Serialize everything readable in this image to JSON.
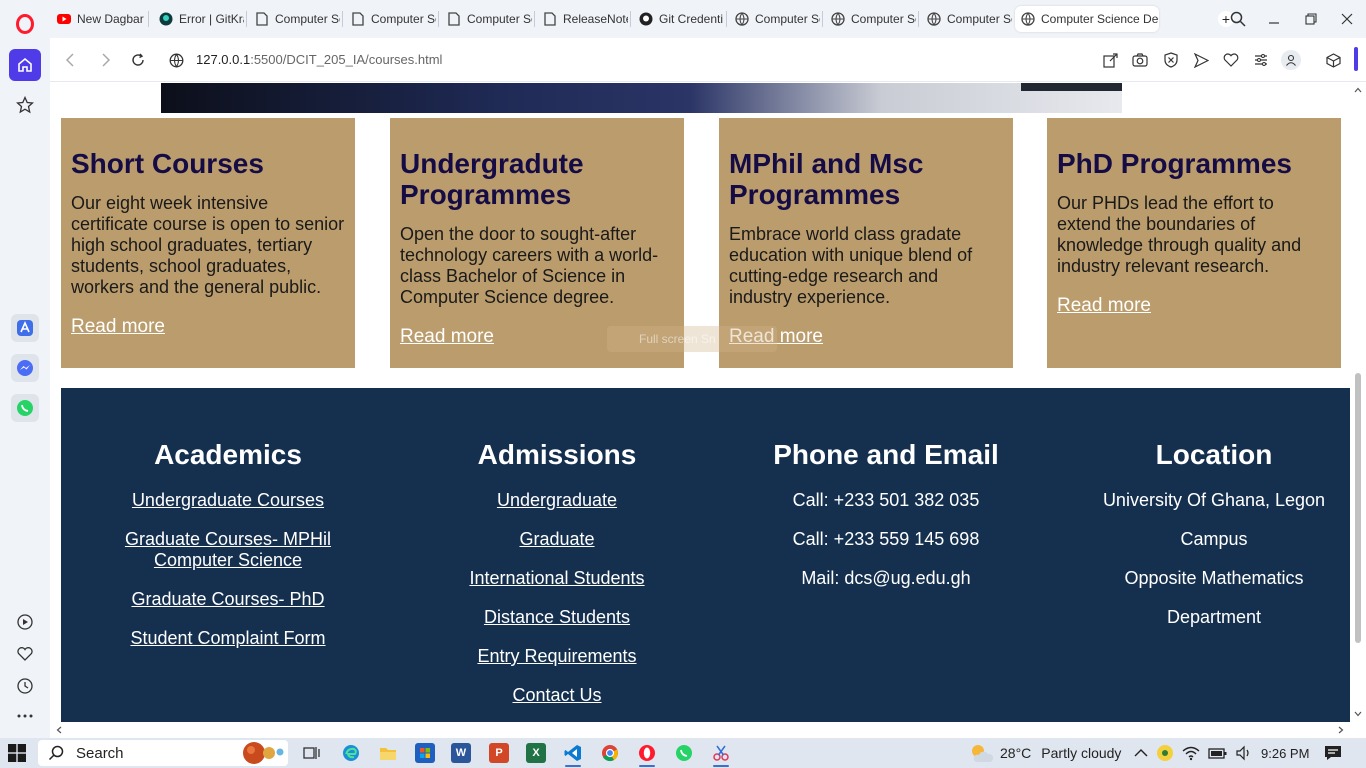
{
  "browser": {
    "tabs": [
      {
        "label": "New Dagbar",
        "icon": "youtube-icon"
      },
      {
        "label": "Error | GitKra",
        "icon": "gitkraken-icon"
      },
      {
        "label": "Computer Sc",
        "icon": "document-icon"
      },
      {
        "label": "Computer Sc",
        "icon": "document-icon"
      },
      {
        "label": "Computer Sc",
        "icon": "document-icon"
      },
      {
        "label": "ReleaseNote",
        "icon": "document-icon"
      },
      {
        "label": "Git Credenti",
        "icon": "github-icon"
      },
      {
        "label": "Computer Sc",
        "icon": "globe-icon"
      },
      {
        "label": "Computer Sc",
        "icon": "globe-icon"
      },
      {
        "label": "Computer Sc",
        "icon": "globe-icon"
      },
      {
        "label": "Computer Science De",
        "icon": "globe-icon",
        "active": true
      }
    ],
    "url_host": "127.0.0.1",
    "url_rest": ":5500/DCIT_205_IA/courses.html"
  },
  "courses": [
    {
      "title": "Short Courses",
      "description": "Our eight week intensive certificate course is open to senior high school graduates, tertiary students, school graduates, workers and the general public.",
      "link": "Read more"
    },
    {
      "title": "Undergradute Programmes",
      "description": "Open the door to sought-after technology careers with a world-class Bachelor of Science in Computer Science degree.",
      "link": "Read more"
    },
    {
      "title": "MPhil and Msc Programmes",
      "description": "Embrace world class gradate education with unique blend of cutting-edge research and industry experience.",
      "link": "Read more"
    },
    {
      "title": "PhD Programmes",
      "description": "Our PHDs lead the effort to extend the boundaries of knowledge through quality and industry relevant research.",
      "link": "Read more"
    }
  ],
  "overlay_hint": "Full screen Sn",
  "footer": {
    "academics": {
      "heading": "Academics",
      "links": [
        "Undergraduate Courses",
        "Graduate Courses- MPHil Computer Science",
        "Graduate Courses- PhD",
        "Student Complaint Form"
      ]
    },
    "admissions": {
      "heading": "Admissions",
      "links": [
        "Undergraduate",
        "Graduate",
        "International Students",
        "Distance Students",
        "Entry Requirements",
        "Contact Us"
      ]
    },
    "contact": {
      "heading": "Phone and Email",
      "lines": [
        "Call: +233 501 382 035",
        "Call: +233 559 145 698",
        "Mail: dcs@ug.edu.gh"
      ]
    },
    "location": {
      "heading": "Location",
      "lines": [
        "University Of Ghana, Legon",
        "Campus",
        "Opposite Mathematics",
        "Department"
      ]
    }
  },
  "taskbar": {
    "search_label": "Search",
    "weather_temp": "28°C",
    "weather_desc": "Partly cloudy",
    "time": "9:26 PM"
  },
  "colors": {
    "card_bg": "#bb9c6c",
    "card_title": "#160c45",
    "footer_bg": "#15304f",
    "opera_accent": "#4f3be8"
  }
}
